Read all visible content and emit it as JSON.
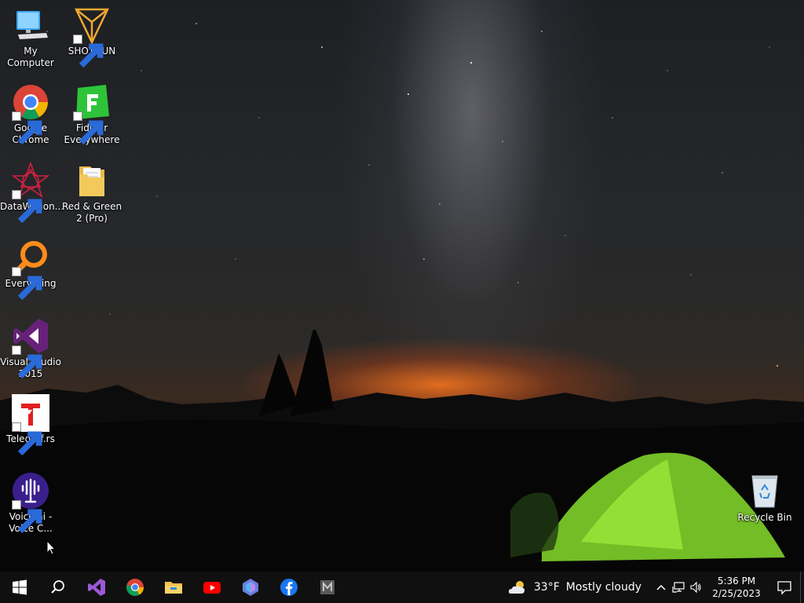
{
  "desktop": {
    "icons": [
      {
        "label": "My Computer",
        "icon": "computer-icon"
      },
      {
        "label": "SHOTGUN",
        "icon": "shotgun-icon"
      },
      {
        "label": "Google Chrome",
        "icon": "chrome-icon"
      },
      {
        "label": "Fiddler Everywhere",
        "icon": "fiddler-icon"
      },
      {
        "label": "DataWagon...",
        "icon": "datawagon-icon"
      },
      {
        "label": "Red & Green 2 (Pro)",
        "icon": "folder-icon"
      },
      {
        "label": "Everything",
        "icon": "everything-search-icon"
      },
      {
        "label": "Visual Studio 2015",
        "icon": "visual-studio-icon"
      },
      {
        "label": "Telegraf.rs",
        "icon": "telegraf-icon"
      },
      {
        "label": "Voice.ai - Voice C...",
        "icon": "voiceai-icon"
      },
      {
        "label": "Recycle Bin",
        "icon": "recycle-bin-icon"
      }
    ]
  },
  "taskbar": {
    "pinned": [
      "start-icon",
      "search-icon",
      "visual-studio-icon",
      "chrome-icon",
      "file-explorer-icon",
      "youtube-icon",
      "app-icon",
      "facebook-icon",
      "m-app-icon"
    ],
    "weather": {
      "temp": "33°F",
      "condition": "Mostly cloudy"
    },
    "clock": {
      "time": "5:36 PM",
      "date": "2/25/2023"
    }
  },
  "colors": {
    "taskbar": "#101010",
    "accent_green": "#7fe02a"
  }
}
